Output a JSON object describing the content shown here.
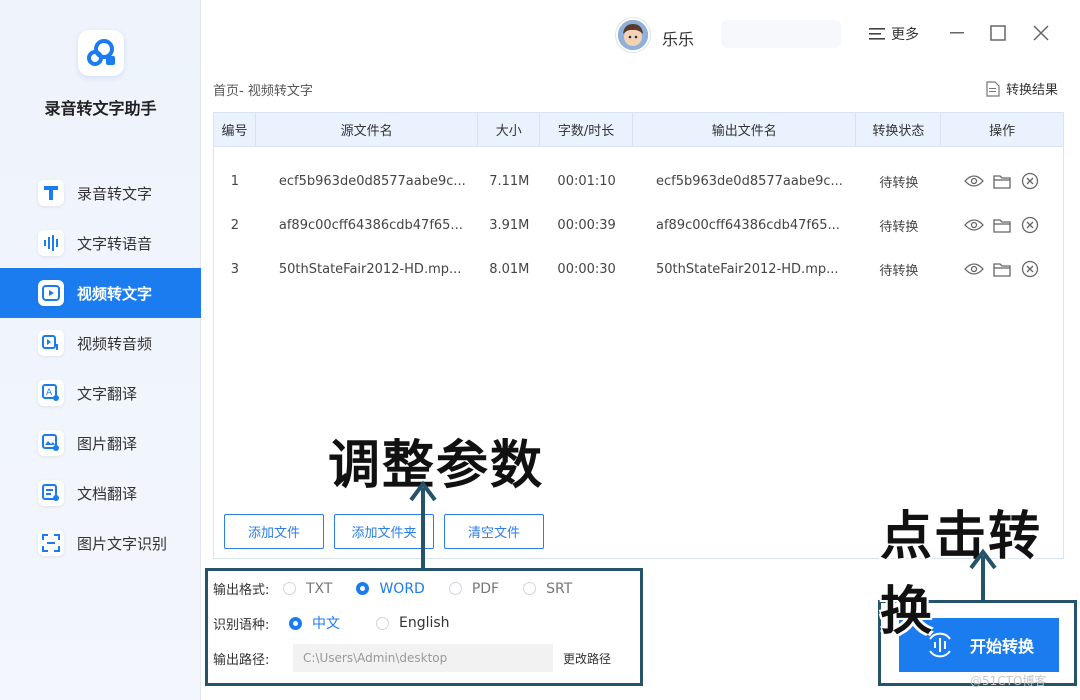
{
  "app": {
    "name": "录音转文字助手"
  },
  "sidebar": {
    "items": [
      {
        "label": "录音转文字",
        "icon": "text-t-icon"
      },
      {
        "label": "文字转语音",
        "icon": "sound-wave-icon"
      },
      {
        "label": "视频转文字",
        "icon": "video-play-icon",
        "active": true
      },
      {
        "label": "视频转音频",
        "icon": "video-audio-icon"
      },
      {
        "label": "文字翻译",
        "icon": "text-translate-icon"
      },
      {
        "label": "图片翻译",
        "icon": "image-translate-icon"
      },
      {
        "label": "文档翻译",
        "icon": "document-translate-icon"
      },
      {
        "label": "图片文字识别",
        "icon": "scan-text-icon"
      }
    ]
  },
  "topbar": {
    "username": "乐乐",
    "more_label": "更多"
  },
  "main": {
    "breadcrumb": "首页- 视频转文字",
    "result_label": "转换结果",
    "table": {
      "headers": [
        "编号",
        "源文件名",
        "大小",
        "字数/时长",
        "输出文件名",
        "转换状态",
        "操作"
      ],
      "rows": [
        {
          "no": "1",
          "source": "ecf5b963de0d8577aabe9c...",
          "size": "7.11M",
          "duration": "00:01:10",
          "output": "ecf5b963de0d8577aabe9c...",
          "status": "待转换"
        },
        {
          "no": "2",
          "source": "af89c00cff64386cdb47f65...",
          "size": "3.91M",
          "duration": "00:00:39",
          "output": "af89c00cff64386cdb47f65...",
          "status": "待转换"
        },
        {
          "no": "3",
          "source": "50thStateFair2012-HD.mp...",
          "size": "8.01M",
          "duration": "00:00:30",
          "output": "50thStateFair2012-HD.mp...",
          "status": "待转换"
        }
      ]
    },
    "buttons": {
      "add_file": "添加文件",
      "add_folder": "添加文件夹",
      "clear": "清空文件"
    }
  },
  "params": {
    "format_label": "输出格式:",
    "formats": [
      {
        "label": "TXT",
        "selected": false
      },
      {
        "label": "WORD",
        "selected": true
      },
      {
        "label": "PDF",
        "selected": false
      },
      {
        "label": "SRT",
        "selected": false
      }
    ],
    "language_label": "识别语种:",
    "languages": [
      {
        "label": "中文",
        "selected": true
      },
      {
        "label": "English",
        "selected": false
      }
    ],
    "path_label": "输出路径:",
    "path_value": "C:\\Users\\Admin\\desktop",
    "change_path": "更改路径"
  },
  "start": {
    "label": "开始转换"
  },
  "annotations": {
    "adjust": "调整参数",
    "click": "点击转换"
  },
  "watermark": "@51CTO博客",
  "colors": {
    "accent": "#1b7cf0",
    "annotation_border": "#24536a"
  }
}
